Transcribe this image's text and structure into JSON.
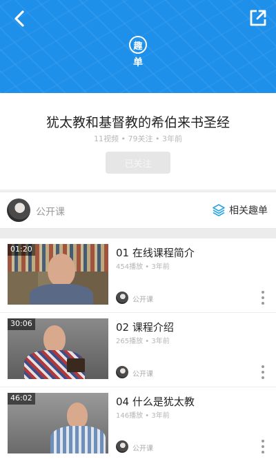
{
  "header": {
    "logo_char": "趣",
    "logo_label": "单",
    "back_icon": "chevron-left-icon",
    "share_icon": "share-external-icon",
    "bg_color": "#1e90ea"
  },
  "playlist": {
    "title": "犹太教和基督教的希伯来书圣经",
    "meta": "11视频 • 79关注 • 3年前",
    "follow_label": "已关注"
  },
  "author": {
    "name": "公开课",
    "related_label": "相关趣单",
    "related_icon": "layers-icon"
  },
  "videos": [
    {
      "duration": "01:20",
      "title": "01 在线课程简介",
      "meta": "454播放 • 3年前",
      "author": "公开课"
    },
    {
      "duration": "30:06",
      "title": "02 课程介绍",
      "meta": "265播放 • 3年前",
      "author": "公开课"
    },
    {
      "duration": "46:02",
      "title": "04 什么是犹太教",
      "meta": "146播放 • 3年前",
      "author": "公开课"
    }
  ]
}
